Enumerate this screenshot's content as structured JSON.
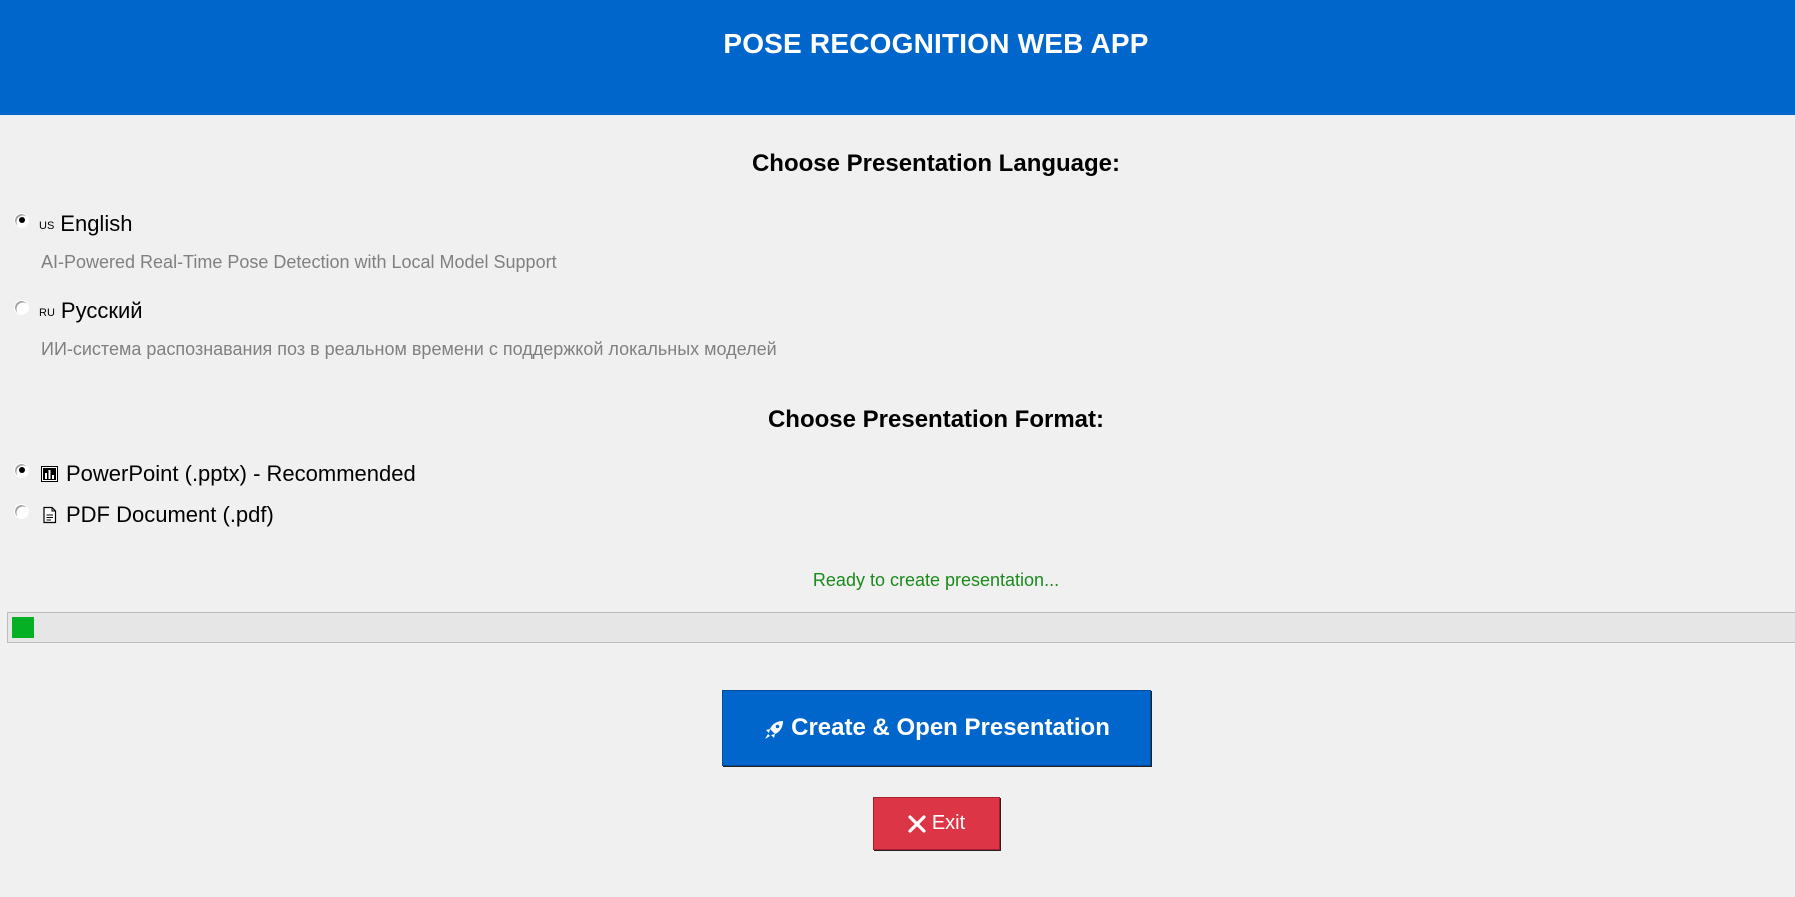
{
  "app": {
    "title": "POSE RECOGNITION WEB APP"
  },
  "language_section": {
    "heading": "Choose Presentation Language:",
    "options": [
      {
        "flag": "US",
        "label": "English",
        "description": "AI-Powered Real-Time Pose Detection with Local Model Support",
        "selected": true
      },
      {
        "flag": "RU",
        "label": "Русский",
        "description": "ИИ-система распознавания поз в реальном времени с поддержкой локальных моделей",
        "selected": false
      }
    ]
  },
  "format_section": {
    "heading": "Choose Presentation Format:",
    "options": [
      {
        "icon": "bar-chart-icon",
        "label": "PowerPoint (.pptx) - Recommended",
        "selected": true
      },
      {
        "icon": "document-icon",
        "label": "PDF Document (.pdf)",
        "selected": false
      }
    ]
  },
  "status": {
    "text": "Ready to create presentation...",
    "progress_fraction": 0.0125
  },
  "actions": {
    "create_label": "Create & Open Presentation",
    "create_icon": "rocket-icon",
    "exit_label": "Exit",
    "exit_icon": "close-icon"
  },
  "colors": {
    "header_bg": "#0066cc",
    "create_button": "#0066cc",
    "exit_button": "#dc3545",
    "status_text": "#1a8a1a",
    "progress_fill": "#06b025"
  }
}
